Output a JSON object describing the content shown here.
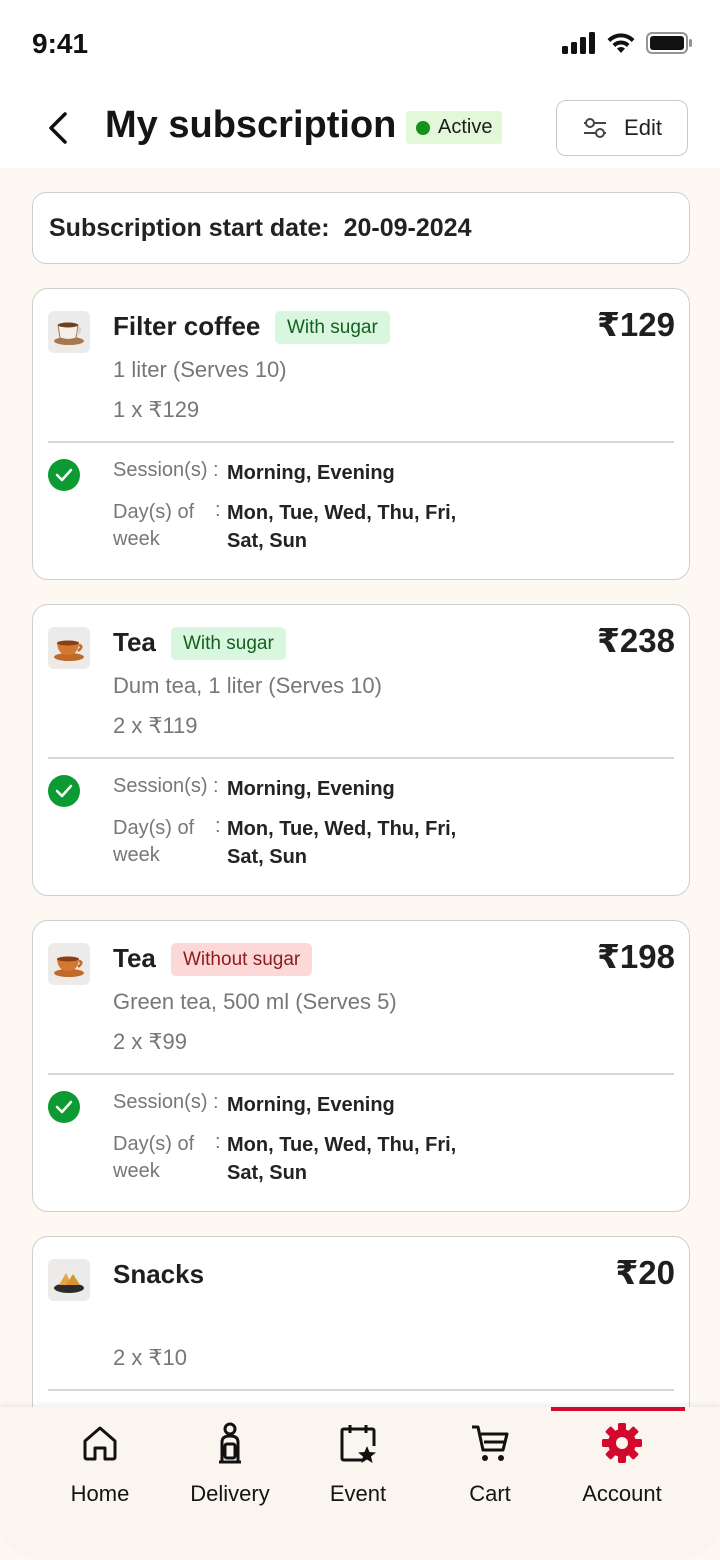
{
  "status_bar": {
    "time": "9:41"
  },
  "header": {
    "title": "My subscription",
    "status": "Active",
    "edit_label": "Edit"
  },
  "start_date": {
    "label": "Subscription start date:",
    "value": "20-09-2024"
  },
  "items": [
    {
      "name": "Filter coffee",
      "tag": "With sugar",
      "tag_type": "green",
      "price": "₹129",
      "desc": "1 liter (Serves 10)",
      "qty": "1 x ₹129",
      "session_label": "Session(s) :",
      "session_value": "Morning, Evening",
      "days_label": "Day(s) of week",
      "days_value": "Mon, Tue, Wed, Thu, Fri, Sat, Sun",
      "icon": "coffee-cup-icon"
    },
    {
      "name": "Tea",
      "tag": "With sugar",
      "tag_type": "green",
      "price": "₹238",
      "desc": "Dum tea, 1 liter (Serves 10)",
      "qty": "2 x ₹119",
      "session_label": "Session(s) :",
      "session_value": "Morning, Evening",
      "days_label": "Day(s) of week",
      "days_value": "Mon, Tue, Wed, Thu, Fri, Sat, Sun",
      "icon": "tea-cup-icon"
    },
    {
      "name": "Tea",
      "tag": "Without sugar",
      "tag_type": "red",
      "price": "₹198",
      "desc": "Green tea, 500 ml (Serves 5)",
      "qty": "2 x ₹99",
      "session_label": "Session(s) :",
      "session_value": "Morning, Evening",
      "days_label": "Day(s) of week",
      "days_value": "Mon, Tue, Wed, Thu, Fri, Sat, Sun",
      "icon": "tea-cup-icon"
    },
    {
      "name": "Snacks",
      "price": "₹20",
      "qty": "2 x ₹10",
      "icon": "snacks-plate-icon"
    }
  ],
  "tab_bar": {
    "tabs": [
      {
        "label": "Home",
        "icon": "home-icon"
      },
      {
        "label": "Delivery",
        "icon": "delivery-person-icon"
      },
      {
        "label": "Event",
        "icon": "event-calendar-icon"
      },
      {
        "label": "Cart",
        "icon": "cart-icon"
      },
      {
        "label": "Account",
        "icon": "gear-icon",
        "active": true
      }
    ]
  },
  "colors": {
    "accent": "#d3082d",
    "active_green": "#12931a",
    "check_green": "#0c9b32",
    "background": "#fdf8f2"
  }
}
